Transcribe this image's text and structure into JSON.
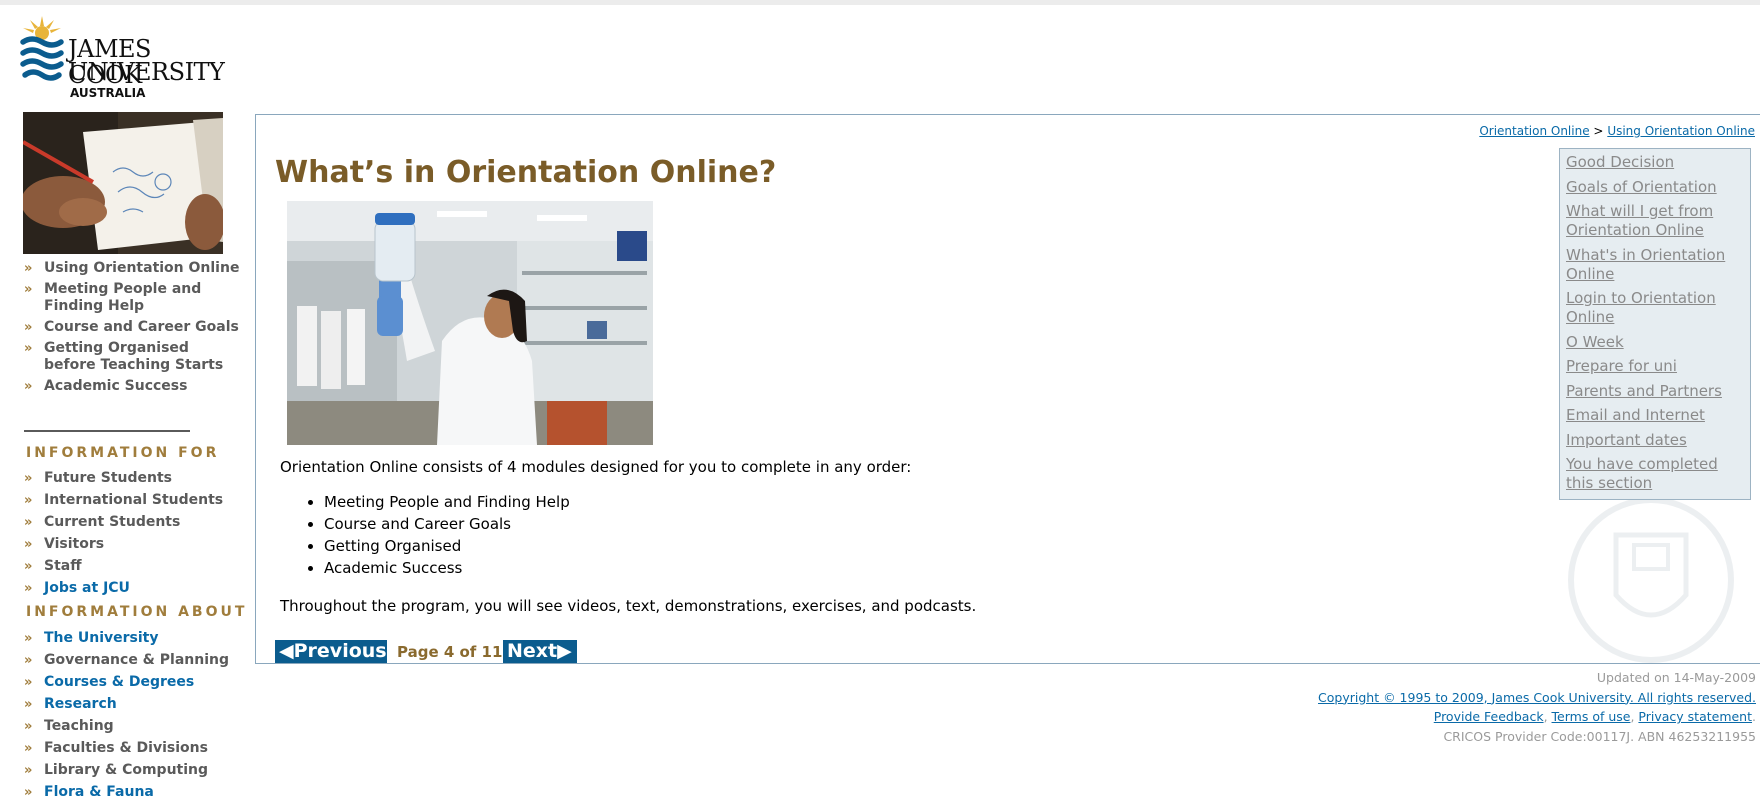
{
  "logo": {
    "line1": "JAMES COOK",
    "line2": "UNIVERSITY",
    "line3": "AUSTRALIA"
  },
  "sidebar": {
    "nav_main": [
      {
        "label": "Using Orientation Online"
      },
      {
        "label": "Meeting People and Finding Help"
      },
      {
        "label": "Course and Career Goals"
      },
      {
        "label": "Getting Organised before Teaching Starts"
      },
      {
        "label": "Academic Success"
      }
    ],
    "info_for_heading": "INFORMATION FOR",
    "info_for": [
      {
        "label": "Future Students"
      },
      {
        "label": "International Students"
      },
      {
        "label": "Current Students"
      },
      {
        "label": "Visitors"
      },
      {
        "label": "Staff"
      },
      {
        "label": "Jobs at JCU"
      }
    ],
    "info_about_heading": "INFORMATION ABOUT",
    "info_about": [
      {
        "label": "The University"
      },
      {
        "label": "Governance & Planning"
      },
      {
        "label": "Courses & Degrees"
      },
      {
        "label": "Research"
      },
      {
        "label": "Teaching"
      },
      {
        "label": "Faculties & Divisions"
      },
      {
        "label": "Library & Computing"
      },
      {
        "label": "Flora & Fauna"
      }
    ],
    "link_blue": "#0a6aa8",
    "link_grey": "#5a5a5a"
  },
  "breadcrumb": {
    "item1": "Orientation Online",
    "separator": ">",
    "item2": "Using Orientation Online"
  },
  "main": {
    "title": "What’s in Orientation Online?",
    "intro": "Orientation Online consists of 4 modules designed for you to complete in any order:",
    "modules": [
      "Meeting People and Finding Help",
      "Course and Career Goals",
      "Getting Organised",
      "Academic Success"
    ],
    "outro": "Throughout the program, you will see videos, text, demonstrations, exercises, and podcasts."
  },
  "pager": {
    "prev_label": "Previous",
    "info": "Page 4 of 11",
    "next_label": "Next",
    "page": 4,
    "total": 11
  },
  "section_menu": [
    "Good Decision",
    "Goals of Orientation",
    "What will I get from Orientation Online",
    "What's in Orientation Online",
    "Login to Orientation Online",
    "O Week",
    "Prepare for uni",
    "Parents and Partners",
    "Email and Internet",
    "Important dates",
    "You have completed this section"
  ],
  "footer": {
    "updated": "Updated on 14-May-2009",
    "copyright": "Copyright © 1995 to 2009, James Cook University. All rights reserved.",
    "feedback": "Provide Feedback",
    "terms": "Terms of use",
    "privacy": "Privacy statement",
    "cricos": "CRICOS Provider Code:00117J.  ABN 46253211955"
  },
  "colors": {
    "brand_gold": "#a07d3c",
    "title_brown": "#7a5c28",
    "pager_blue": "#0b5c8e",
    "panel_border": "#8aa7bd"
  }
}
